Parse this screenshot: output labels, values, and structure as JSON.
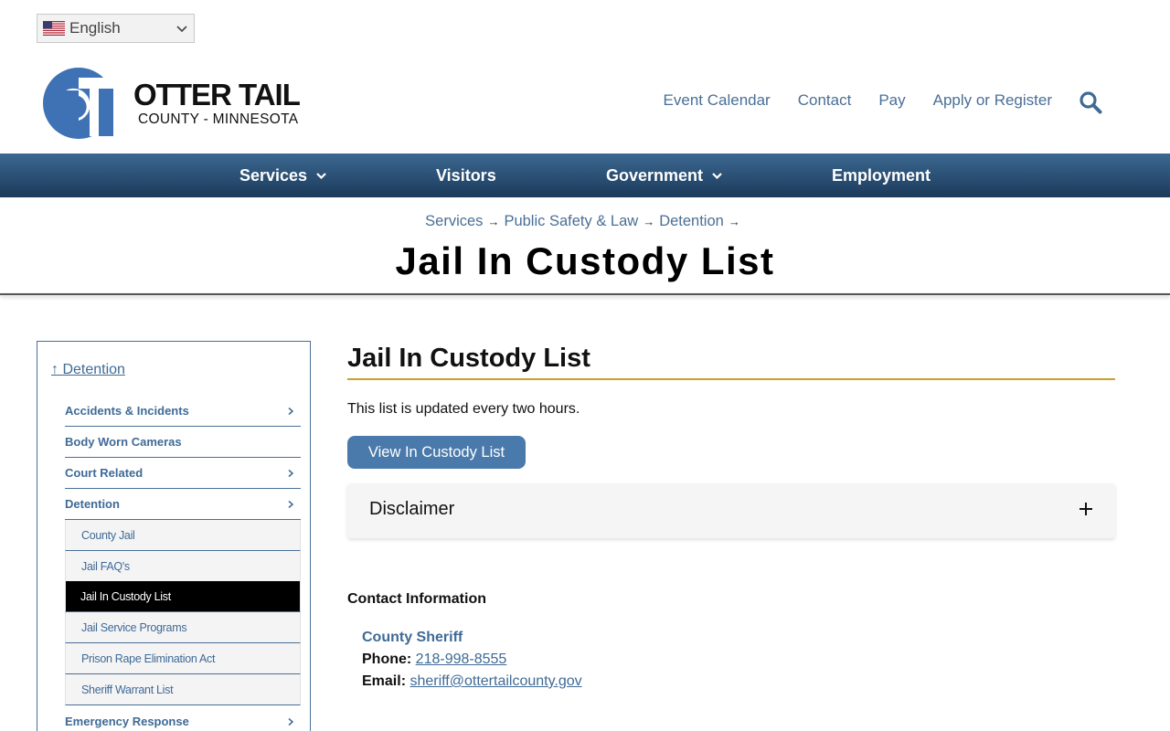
{
  "language": {
    "selected": "English",
    "flag": "us-flag-icon"
  },
  "logo": {
    "name": "OTTER TAIL",
    "subtitle": "COUNTY - MINNESOTA"
  },
  "utility_nav": [
    "Event Calendar",
    "Contact",
    "Pay",
    "Apply or Register"
  ],
  "main_nav": [
    {
      "label": "Services",
      "has_dropdown": true
    },
    {
      "label": "Visitors",
      "has_dropdown": false
    },
    {
      "label": "Government",
      "has_dropdown": true
    },
    {
      "label": "Employment",
      "has_dropdown": false
    }
  ],
  "breadcrumb": [
    "Services",
    "Public Safety & Law",
    "Detention"
  ],
  "page_title": "Jail In Custody List",
  "sidebar": {
    "parent_link": "↑ Detention",
    "items": [
      {
        "label": "Accidents & Incidents",
        "has_children": true
      },
      {
        "label": "Body Worn Cameras",
        "has_children": false
      },
      {
        "label": "Court Related",
        "has_children": true
      },
      {
        "label": "Detention",
        "has_children": true
      }
    ],
    "subitems": [
      {
        "label": "County Jail",
        "active": false
      },
      {
        "label": "Jail FAQ's",
        "active": false
      },
      {
        "label": "Jail In Custody List",
        "active": true
      },
      {
        "label": "Jail Service Programs",
        "active": false
      },
      {
        "label": "Prison Rape Elimination Act",
        "active": false
      },
      {
        "label": "Sheriff Warrant List",
        "active": false
      }
    ],
    "after_items": [
      {
        "label": "Emergency Response",
        "has_children": true
      }
    ]
  },
  "content": {
    "heading": "Jail In Custody List",
    "intro": "This list is updated every two hours.",
    "button_label": "View In Custody List",
    "accordion_title": "Disclaimer",
    "contact_heading": "Contact Information",
    "contact_name": "County Sheriff",
    "phone_label": "Phone:",
    "phone": "218-998-8555",
    "email_label": "Email:",
    "email": "sheriff@ottertailcounty.gov"
  },
  "colors": {
    "link_blue": "#4a6f96",
    "nav_top": "#3c6891",
    "nav_bottom": "#1b3a5b",
    "accent_gold": "#c9a227",
    "button_blue": "#4a7aab",
    "logo_blue": "#3f72b5"
  }
}
